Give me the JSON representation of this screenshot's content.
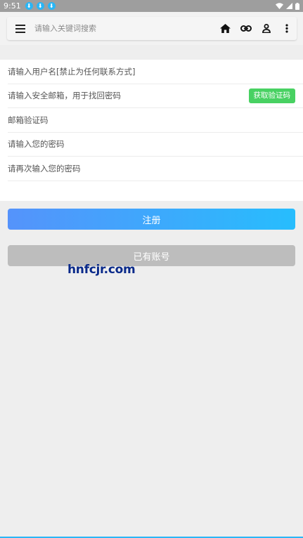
{
  "status_bar": {
    "time": "9:51",
    "notifications": [
      "download-icon",
      "download-icon",
      "download-icon"
    ],
    "icons": [
      "wifi-icon",
      "signal-icon",
      "battery-icon"
    ]
  },
  "toolbar": {
    "search_placeholder": "请输入关键词搜索",
    "icons": [
      "menu-icon",
      "home-icon",
      "link-icon",
      "user-icon",
      "more-vert-icon"
    ]
  },
  "form": {
    "username_placeholder": "请输入用户名[禁止为任何联系方式]",
    "email_placeholder": "请输入安全邮箱，用于找回密码",
    "get_code_label": "获取验证码",
    "code_placeholder": "邮箱验证码",
    "password_placeholder": "请输入您的密码",
    "confirm_password_placeholder": "请再次输入您的密码"
  },
  "buttons": {
    "register_label": "注册",
    "have_account_label": "已有账号"
  },
  "watermark": "hnfcjr.com",
  "colors": {
    "status_bar": "#9e9e9e",
    "code_button": "#48d162",
    "register_gradient_start": "#5593fb",
    "register_gradient_end": "#27bdfd",
    "have_account": "#bdbdbd",
    "background": "#eeeeee"
  }
}
